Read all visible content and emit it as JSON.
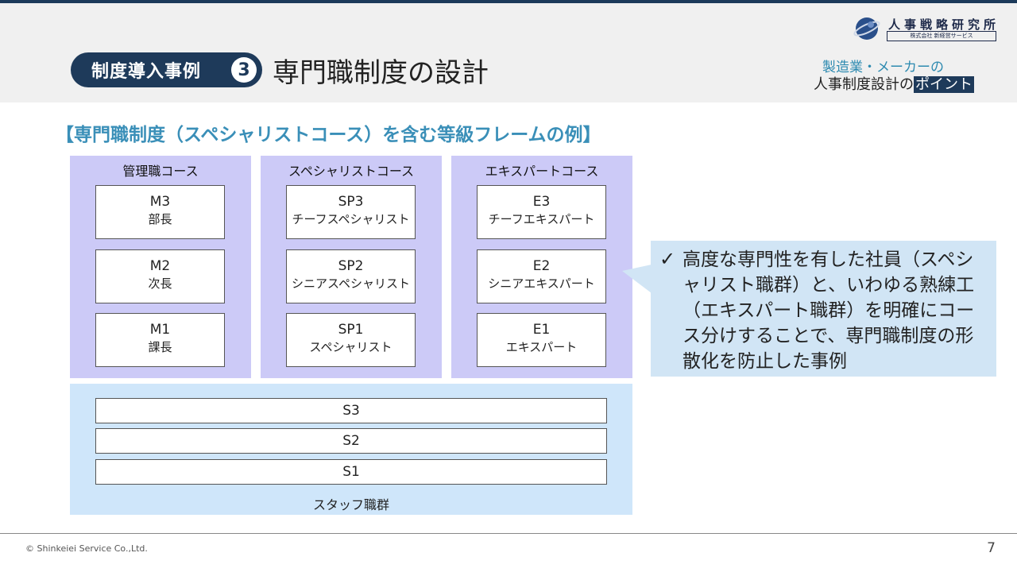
{
  "header": {
    "badge_label": "制度導入事例",
    "badge_number": "3",
    "title": "専門職制度の設計",
    "logo_name": "人事戦略研究所",
    "logo_sub": "株式会社 新経営サービス",
    "tagline_line1": "製造業・メーカーの",
    "tagline_line2_prefix": "人事制度設計の",
    "tagline_line2_highlight": "ポイント"
  },
  "subtitle": "【専門職制度（スペシャリストコース）を含む等級フレームの例】",
  "courses": [
    {
      "title": "管理職コース",
      "grades": [
        {
          "code": "M3",
          "name": "部長"
        },
        {
          "code": "M2",
          "name": "次長"
        },
        {
          "code": "M1",
          "name": "課長"
        }
      ]
    },
    {
      "title": "スペシャリストコース",
      "grades": [
        {
          "code": "SP3",
          "name": "チーフスペシャリスト"
        },
        {
          "code": "SP2",
          "name": "シニアスペシャリスト"
        },
        {
          "code": "SP1",
          "name": "スペシャリスト"
        }
      ]
    },
    {
      "title": "エキスパートコース",
      "grades": [
        {
          "code": "E3",
          "name": "チーフエキスパート"
        },
        {
          "code": "E2",
          "name": "シニアエキスパート"
        },
        {
          "code": "E1",
          "name": "エキスパート"
        }
      ]
    }
  ],
  "staff": {
    "grades": [
      "S3",
      "S2",
      "S1"
    ],
    "label": "スタッフ職群"
  },
  "note": {
    "check": "✓",
    "text": "高度な専門性を有した社員（スペシャリスト職群）と、いわゆる熟練工（エキスパート職群）を明確にコース分けすることで、専門職制度の形散化を防止した事例"
  },
  "footer": {
    "copyright": "© Shinkeiei Service Co.,Ltd.",
    "page": "7"
  },
  "colors": {
    "navy": "#1e3a5a",
    "course_bg": "#cccaf7",
    "staff_bg": "#cfe6fa",
    "note_bg": "#d1e5f5",
    "subtitle": "#3a8fb8"
  }
}
